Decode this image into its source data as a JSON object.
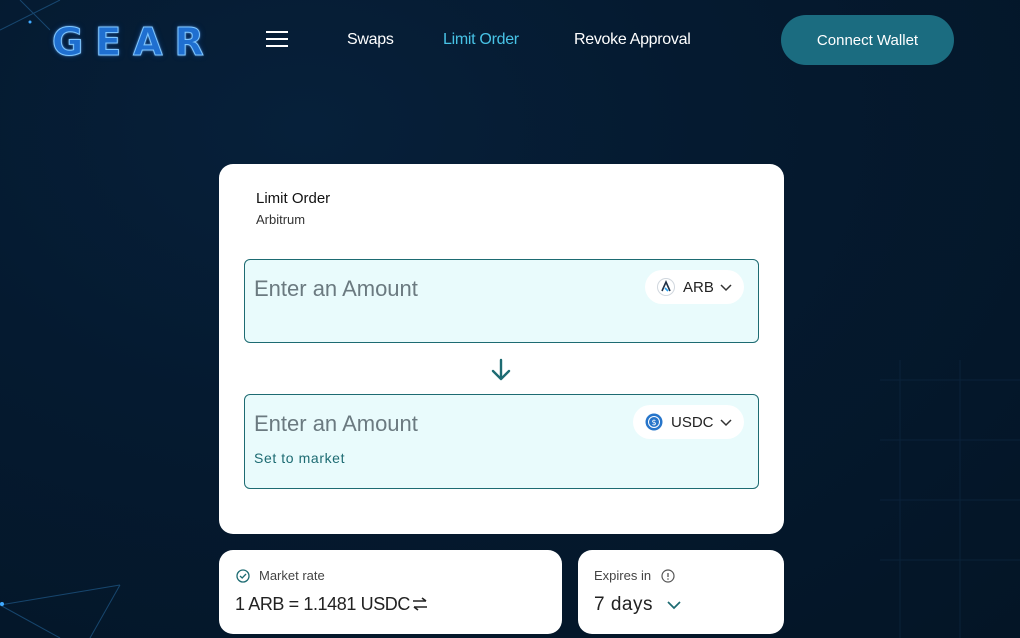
{
  "header": {
    "logo": "GEAR",
    "nav": [
      {
        "label": "Swaps"
      },
      {
        "label": "Limit Order"
      },
      {
        "label": "Revoke Approval"
      }
    ],
    "connect_label": "Connect Wallet",
    "active_nav": "Limit Order",
    "accent": "#48c3e6"
  },
  "card": {
    "title": "Limit Order",
    "network": "Arbitrum",
    "from": {
      "placeholder": "Enter an Amount",
      "token": "ARB",
      "icon": "arbitrum-icon"
    },
    "to": {
      "placeholder": "Enter an Amount",
      "token": "USDC",
      "icon": "usdc-icon",
      "set_market": "Set to market"
    }
  },
  "rate": {
    "label": "Market rate",
    "value": "1 ARB = 1.1481 USDC"
  },
  "expires": {
    "label": "Expires in",
    "value": "7 days"
  },
  "colors": {
    "primary": "#1b6c80",
    "box_bg": "#e9fbfc",
    "box_border": "#1d6b72"
  }
}
